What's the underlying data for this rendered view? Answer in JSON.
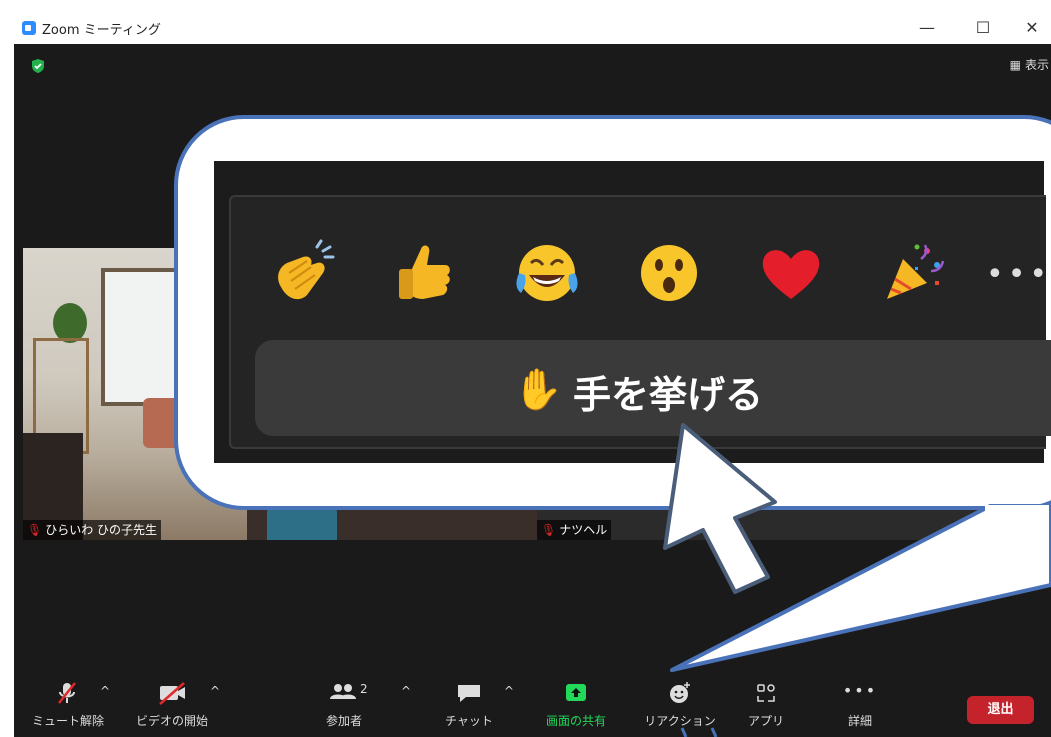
{
  "window": {
    "title": "Zoom ミーティング",
    "minimize": "—",
    "maximize": "☐",
    "close": "✕"
  },
  "view": {
    "label": "表示"
  },
  "participants": {
    "left_name": "ひらいわ ひの子先生",
    "right_name": "ナツヘル"
  },
  "reactions": {
    "emojis": [
      {
        "name": "clap",
        "glyph": "👏"
      },
      {
        "name": "thumbs-up",
        "glyph": "👍"
      },
      {
        "name": "tears-of-joy",
        "glyph": "😂"
      },
      {
        "name": "surprised",
        "glyph": "😮"
      },
      {
        "name": "heart",
        "glyph": "❤"
      },
      {
        "name": "party",
        "glyph": "🎉"
      }
    ],
    "more": "•••",
    "raise_hand_label": "手を挙げる",
    "raise_hand_glyph": "✋"
  },
  "toolbar": {
    "mute_label": "ミュート解除",
    "video_label": "ビデオの開始",
    "participants_label": "参加者",
    "participants_count": "2",
    "chat_label": "チャット",
    "share_label": "画面の共有",
    "reaction_label": "リアクション",
    "apps_label": "アプリ",
    "more_label": "詳細",
    "more_dots": "•••",
    "exit_label": "退出",
    "caret": "^"
  },
  "colors": {
    "share_green": "#23d959",
    "exit_red": "#c4232c",
    "callout_border": "#4a72b8"
  }
}
